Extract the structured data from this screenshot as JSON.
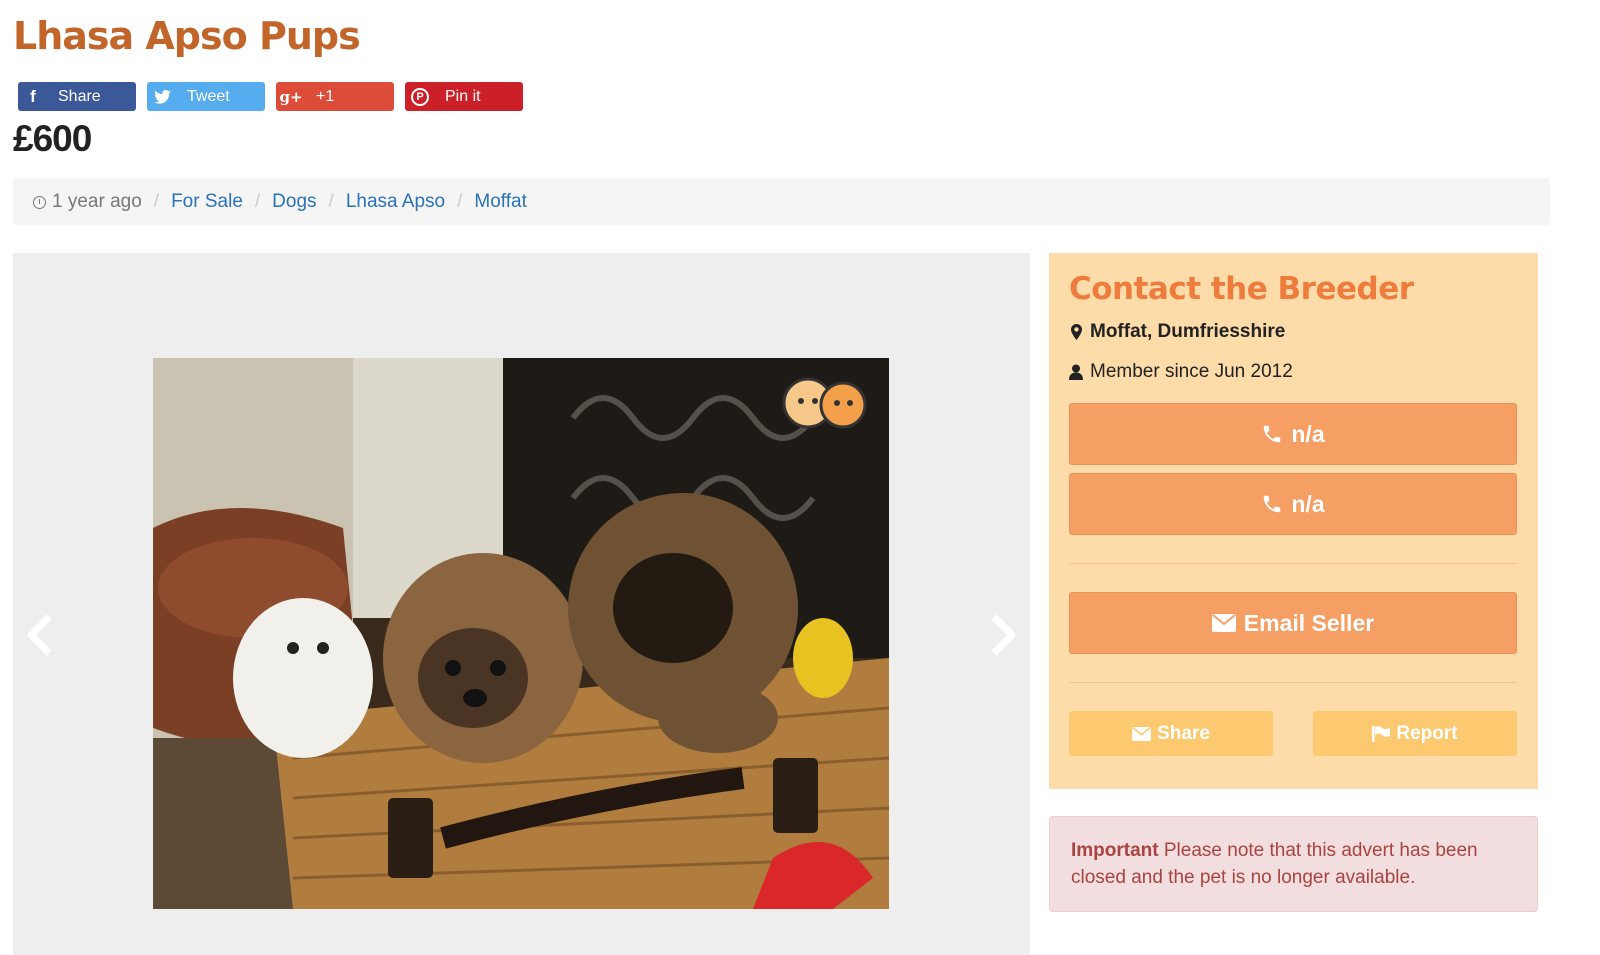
{
  "listing": {
    "title": "Lhasa Apso Pups",
    "price": "£600"
  },
  "share_buttons": {
    "facebook": {
      "label": "Share",
      "icon": "facebook-icon",
      "color": "#3b5998"
    },
    "twitter": {
      "label": "Tweet",
      "icon": "twitter-icon",
      "color": "#55acee"
    },
    "googleplus": {
      "label": "+1",
      "icon": "google-plus-icon",
      "glyph": "g+",
      "color": "#dd4b39"
    },
    "pinterest": {
      "label": "Pin it",
      "icon": "pinterest-icon",
      "color": "#cb2027"
    }
  },
  "breadcrumb": {
    "age": "1 year ago",
    "items": [
      "For Sale",
      "Dogs",
      "Lhasa Apso",
      "Moffat"
    ]
  },
  "gallery": {
    "photo_alt": "Two Lhasa Apso puppies in a wicker basket",
    "prev_icon": "chevron-left-icon",
    "next_icon": "chevron-right-icon"
  },
  "contact": {
    "heading": "Contact the Breeder",
    "location": "Moffat, Dumfriesshire",
    "member_since": "Member since Jun 2012",
    "phone_1": "n/a",
    "phone_2": "n/a",
    "email_label": "Email Seller",
    "share_label": "Share",
    "report_label": "Report",
    "colors": {
      "heading": "#ee7d3d",
      "panel": "#fedcaa",
      "primary_button": "#f59f64",
      "secondary_button": "#fdc970"
    }
  },
  "alert": {
    "strong": "Important",
    "text": " Please note that this advert has been closed and the pet is no longer available."
  },
  "colors": {
    "title": "#c1652a",
    "link": "#2a73b8"
  }
}
